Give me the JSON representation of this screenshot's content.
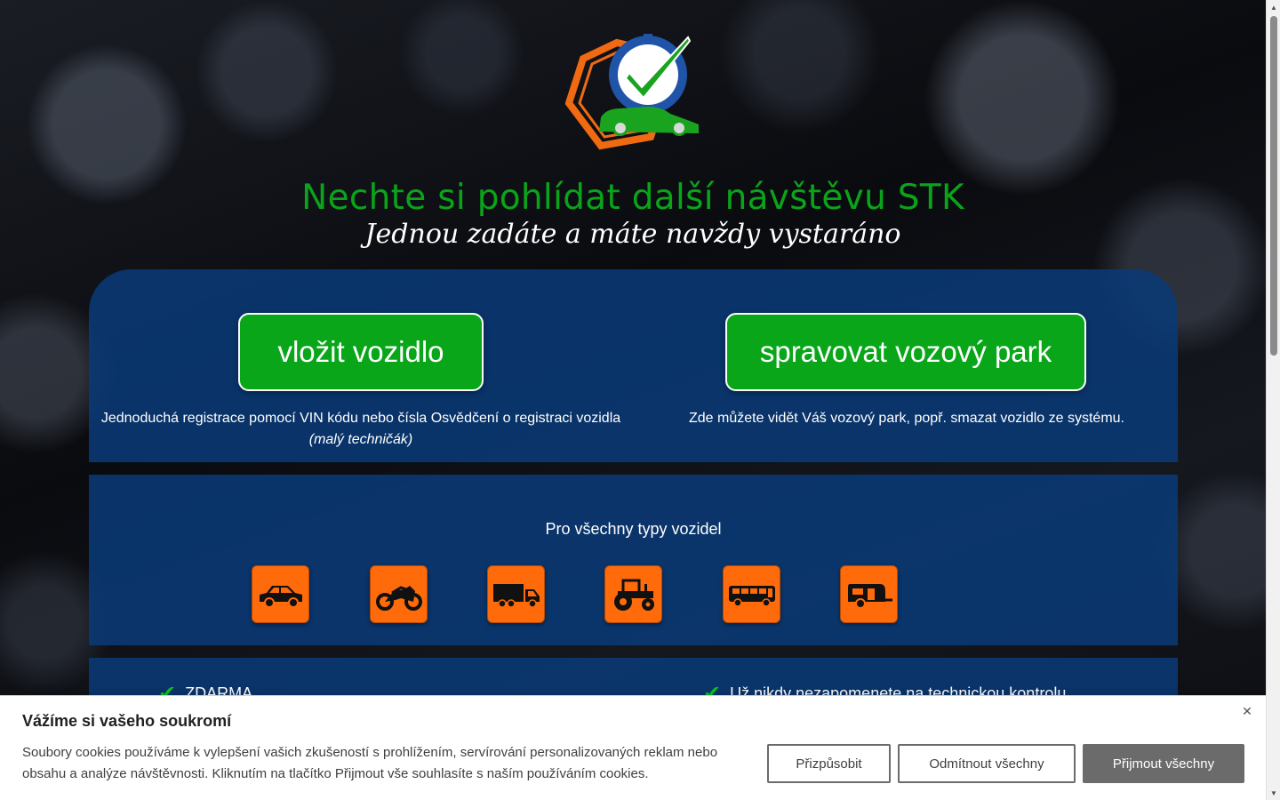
{
  "hero": {
    "headline": "Nechte si pohlídat další návštěvu STK",
    "tagline": "Jednou zadáte a máte navždy vystaráno"
  },
  "actions": {
    "add_vehicle": {
      "label": "vložit vozidlo",
      "description": "Jednoduchá registrace pomocí VIN kódu nebo čísla Osvědčení o registraci vozidla",
      "description_note": "(malý techničák)"
    },
    "manage_fleet": {
      "label": "spravovat vozový park",
      "description": "Zde můžete vidět Váš vozový park, popř. smazat vozidlo ze systému."
    }
  },
  "vehicle_types": {
    "title": "Pro všechny typy vozidel",
    "items": [
      {
        "icon": "car-icon"
      },
      {
        "icon": "motorcycle-icon"
      },
      {
        "icon": "truck-icon"
      },
      {
        "icon": "tractor-icon"
      },
      {
        "icon": "bus-icon"
      },
      {
        "icon": "caravan-icon"
      }
    ]
  },
  "features": {
    "left": "ZDARMA",
    "right": "Už nikdy nezapomenete na technickou kontrolu"
  },
  "cookie_banner": {
    "title": "Vážíme si vašeho soukromí",
    "text": "Soubory cookies používáme k vylepšení vašich zkušeností s prohlížením, servírování personalizovaných reklam nebo obsahu a analýze návštěvnosti. Kliknutím na tlačítko Přijmout vše souhlasíte s naším používáním cookies.",
    "customize_label": "Přizpůsobit",
    "reject_label": "Odmítnout všechny",
    "accept_label": "Přijmout všechny"
  },
  "colors": {
    "brand_green": "#0aa61a",
    "panel_blue": "#093a78",
    "icon_orange": "#ff6a0a"
  }
}
